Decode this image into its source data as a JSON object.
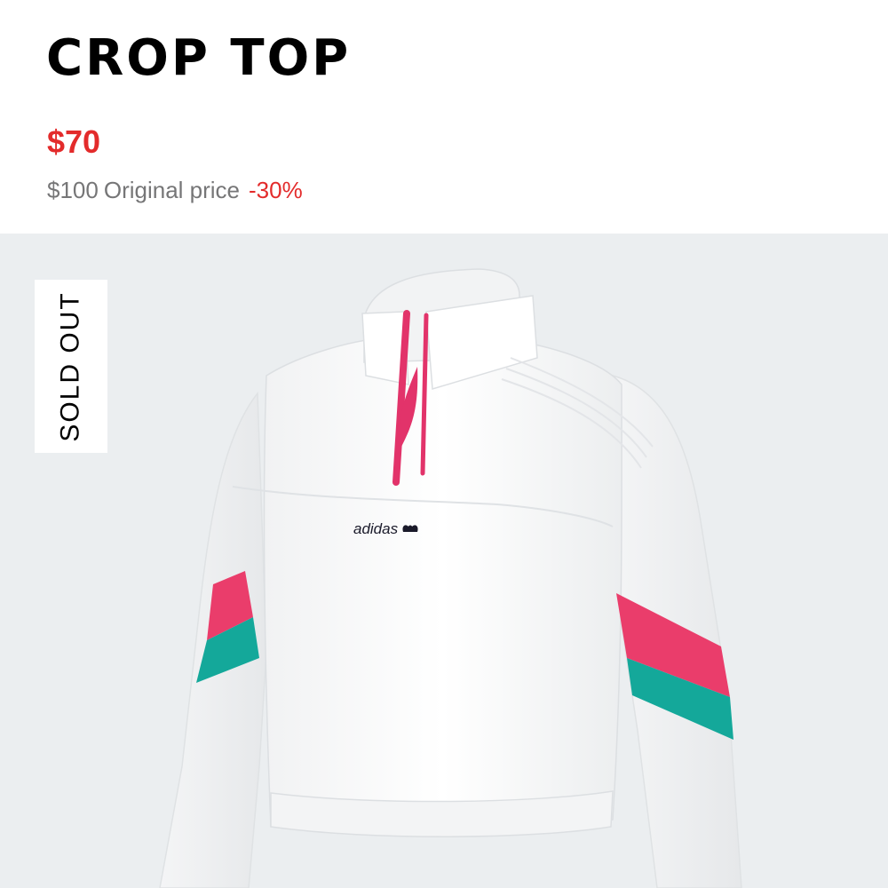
{
  "product": {
    "title": "CROP TOP",
    "sale_price": "$70",
    "original_price": "$100",
    "original_label": "Original price",
    "discount": "-30%"
  },
  "badge": {
    "label": "SOLD OUT"
  },
  "image": {
    "brand_text": "adidas",
    "icon": "adidas-trefoil-icon"
  },
  "colors": {
    "sale_red": "#e32b2b",
    "muted_gray": "#767677",
    "image_bg": "#ebeef0",
    "stripe_pink": "#ea3d6b",
    "stripe_teal": "#14a89a",
    "zipper_pink": "#e2336a"
  }
}
